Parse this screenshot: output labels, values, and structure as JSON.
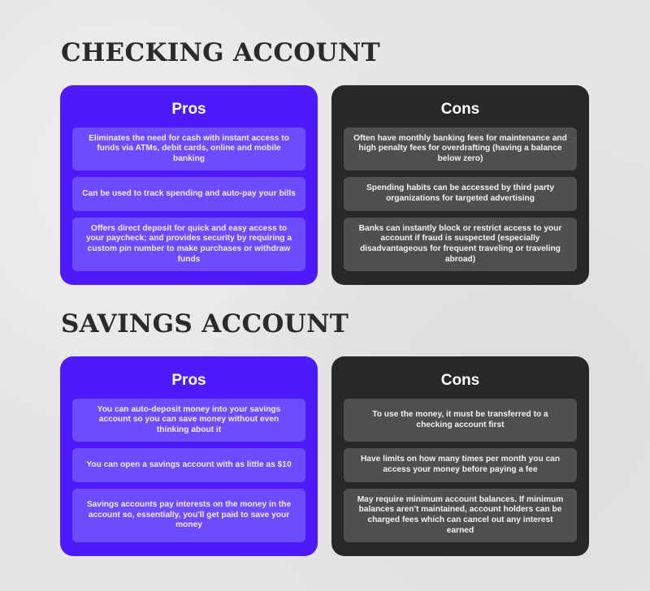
{
  "sections": [
    {
      "title": "CHECKING ACCOUNT",
      "pros": {
        "heading": "Pros",
        "items": [
          "Eliminates the need for cash with instant access to funds via ATMs, debit cards, online and mobile banking",
          "Can be used to track spending and auto-pay your bills",
          "Offers direct deposit for quick and easy access to your paycheck; and provides security by requiring a custom pin number to make purchases or withdraw funds"
        ]
      },
      "cons": {
        "heading": "Cons",
        "items": [
          "Often have monthly banking fees for maintenance and high penalty fees for overdrafting (having a balance below zero)",
          "Spending habits can be accessed by third party organizations for targeted advertising",
          "Banks can instantly block or restrict access to your account if fraud is suspected (especially disadvantageous for frequent traveling or traveling abroad)"
        ]
      }
    },
    {
      "title": "SAVINGS ACCOUNT",
      "pros": {
        "heading": "Pros",
        "items": [
          "You can auto-deposit money into your savings account so you can save money without even thinking about it",
          "You can open a savings account with as little as $10",
          "Savings accounts pay interests on the money in the account so, essentially, you'll get paid to save your money"
        ]
      },
      "cons": {
        "heading": "Cons",
        "items": [
          "To use the money, it must be transferred to a checking account first",
          "Have limits on how many times per month you can access your money before paying a fee",
          "May require minimum account balances. If minimum balances aren't maintained, account holders can be charged fees which can cancel out any interest earned"
        ]
      }
    }
  ],
  "colors": {
    "pros_card": "#4d1bfb",
    "pros_item": "#6d4bff",
    "cons_card": "#282828",
    "cons_item": "#4f4f4f",
    "title_text": "#2b2b2b",
    "background": "#e6e6e6"
  }
}
